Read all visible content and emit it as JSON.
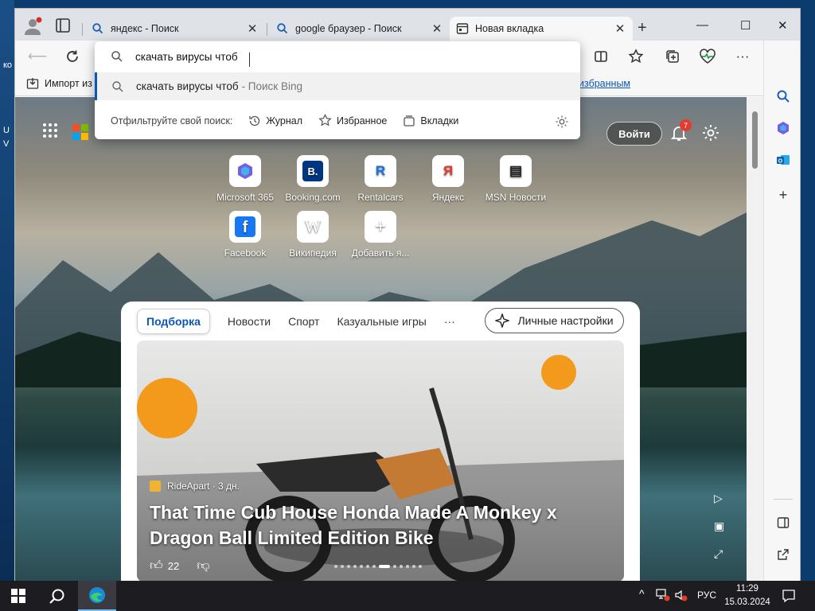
{
  "desktop": {
    "labels": [
      "ко",
      "U",
      "V"
    ]
  },
  "tabs": [
    {
      "label": "яндекс - Поиск",
      "icon": "search-icon"
    },
    {
      "label": "google браузер - Поиск",
      "icon": "search-icon"
    },
    {
      "label": "Новая вкладка",
      "icon": "newtab-icon",
      "active": true
    }
  ],
  "toolbar": {
    "address_value": "скачать вирусы чтоб"
  },
  "dropdown": {
    "suggestion": "скачать вирусы чтоб",
    "suggestion_suffix": "- Поиск Bing",
    "filter_label": "Отфильтруйте свой поиск:",
    "filters": [
      "Журнал",
      "Избранное",
      "Вкладки"
    ]
  },
  "favbar": {
    "import": "Импорт из",
    "right": "избранным"
  },
  "ntp": {
    "signin": "Войти",
    "notif_count": "7",
    "quicklinks": [
      {
        "label": "Microsoft 365",
        "glyph": "",
        "color": "#7b5ce6"
      },
      {
        "label": "Booking.com",
        "glyph": "B.",
        "color": "#003580"
      },
      {
        "label": "Rentalcars",
        "glyph": "R",
        "color": "#1b6fe0"
      },
      {
        "label": "Яндекс",
        "glyph": "Я",
        "color": "#e03b2e"
      },
      {
        "label": "MSN Новости",
        "glyph": "▤",
        "color": "#222"
      },
      {
        "label": "Facebook",
        "glyph": "f",
        "color": "#1877f2"
      },
      {
        "label": "Википедия",
        "glyph": "W",
        "color": "#111"
      },
      {
        "label": "Добавить я...",
        "glyph": "+",
        "color": "#333"
      }
    ],
    "feed_tabs": [
      "Подборка",
      "Новости",
      "Спорт",
      "Казуальные игры",
      "···"
    ],
    "personalize": "Личные настройки",
    "card": {
      "source": "RideApart · 3 дн.",
      "title": "That Time Cub House Honda Made A Monkey x Dragon Ball Limited Edition Bike",
      "likes": "22"
    }
  },
  "taskbar": {
    "lang": "РУС",
    "time": "11:29",
    "date": "15.03.2024"
  }
}
